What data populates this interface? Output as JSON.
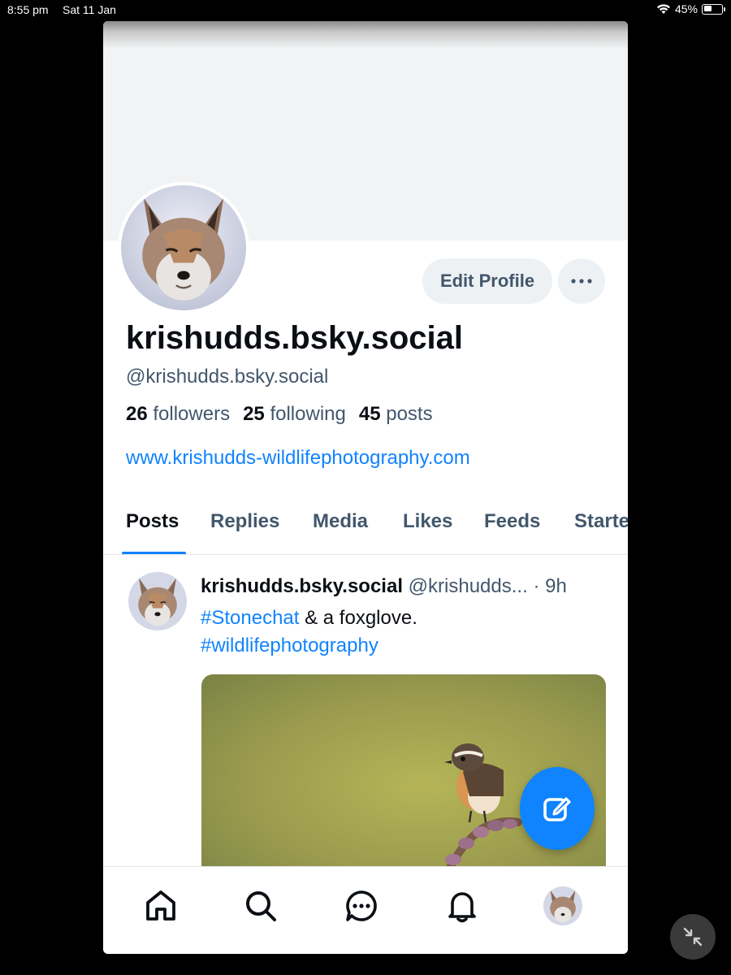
{
  "status_bar": {
    "time": "8:55 pm",
    "date": "Sat 11 Jan",
    "battery_text": "45%",
    "battery_level": 0.45
  },
  "profile": {
    "display_name": "krishudds.bsky.social",
    "handle": "@krishudds.bsky.social",
    "followers_count": "26",
    "followers_label": "followers",
    "following_count": "25",
    "following_label": "following",
    "posts_count": "45",
    "posts_label": "posts",
    "website": "www.krishudds-wildlifephotography.com",
    "edit_button": "Edit Profile"
  },
  "tabs": [
    {
      "label": "Posts",
      "active": true
    },
    {
      "label": "Replies",
      "active": false
    },
    {
      "label": "Media",
      "active": false
    },
    {
      "label": "Likes",
      "active": false
    },
    {
      "label": "Feeds",
      "active": false
    },
    {
      "label": "Starter Packs",
      "active": false
    }
  ],
  "post": {
    "author": "krishudds.bsky.social",
    "handle": "@krishudds...",
    "separator": "·",
    "time": "9h",
    "tag1": "#Stonechat",
    "text": " & a foxglove.",
    "tag2": "#wildlifephotography"
  },
  "icons": {
    "nav": [
      "home-icon",
      "search-icon",
      "chat-icon",
      "bell-icon",
      "profile-avatar"
    ],
    "fab": "compose-icon",
    "minimize": "minimize-icon"
  },
  "colors": {
    "accent": "#1083fe",
    "text_primary": "#0b0f14",
    "text_secondary": "#42576c",
    "banner": "#f1f3f5"
  }
}
